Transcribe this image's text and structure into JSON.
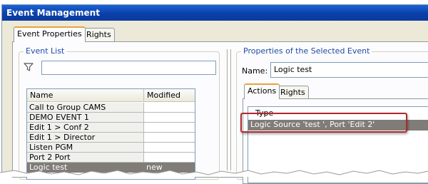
{
  "window": {
    "title": "Event Management"
  },
  "tabs": [
    {
      "label": "Event Properties",
      "active": true
    },
    {
      "label": "Rights",
      "active": false
    }
  ],
  "event_list": {
    "group_label": "Event List",
    "filter": {
      "icon": "filter-icon",
      "value": ""
    },
    "columns": [
      "Name",
      "Modified"
    ],
    "rows": [
      {
        "name": "Call to Group CAMS",
        "modified": "",
        "selected": false
      },
      {
        "name": "DEMO EVENT 1",
        "modified": "",
        "selected": false
      },
      {
        "name": "Edit 1 > Conf 2",
        "modified": "",
        "selected": false
      },
      {
        "name": "Edit 1 > Director",
        "modified": "",
        "selected": false
      },
      {
        "name": "Listen PGM",
        "modified": "",
        "selected": false
      },
      {
        "name": "Port 2 Port",
        "modified": "",
        "selected": false
      },
      {
        "name": "Logic test",
        "modified": "new",
        "selected": true
      }
    ]
  },
  "properties": {
    "group_label": "Properties of the Selected Event",
    "name_label": "Name:",
    "name_value": "Logic test",
    "subtabs": [
      {
        "label": "Actions",
        "active": true
      },
      {
        "label": "Rights",
        "active": false
      }
    ],
    "actions_columns": [
      "Type"
    ],
    "actions_rows": [
      "Logic Source 'test ', Port 'Edit 2'"
    ]
  },
  "colors": {
    "title_bar": "#0b3fa8",
    "selection": "#807c78",
    "highlight_box": "#b2282c",
    "tab_accent": "#e8a33c"
  }
}
